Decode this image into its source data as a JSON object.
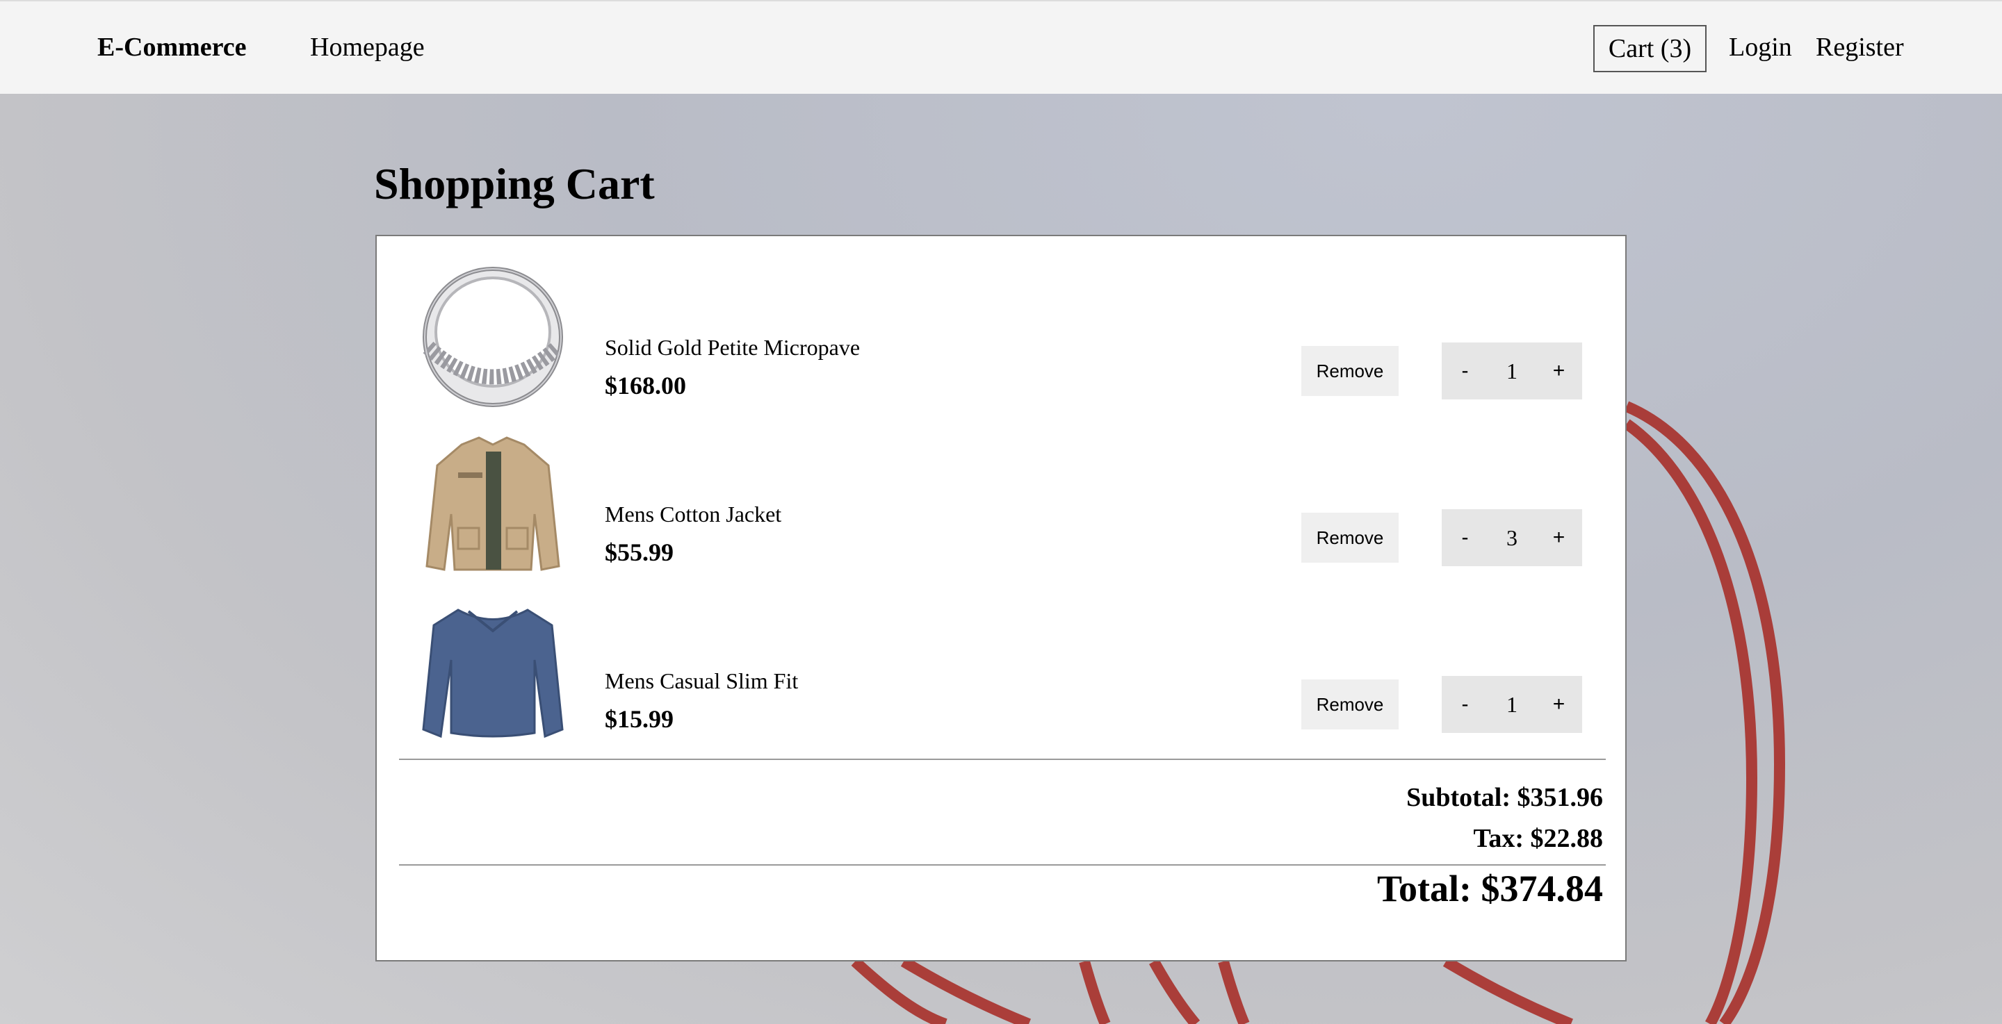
{
  "navbar": {
    "brand": "E-Commerce",
    "home": "Homepage",
    "cart": "Cart (3)",
    "login": "Login",
    "register": "Register"
  },
  "page": {
    "title": "Shopping Cart"
  },
  "cart": {
    "remove_label": "Remove",
    "minus_label": "-",
    "plus_label": "+",
    "items": [
      {
        "name": "Solid Gold Petite Micropave",
        "price": "$168.00",
        "quantity": "1",
        "image": "ring-icon"
      },
      {
        "name": "Mens Cotton Jacket",
        "price": "$55.99",
        "quantity": "3",
        "image": "jacket-icon"
      },
      {
        "name": "Mens Casual Slim Fit",
        "price": "$15.99",
        "quantity": "1",
        "image": "shirt-icon"
      }
    ],
    "subtotal": "Subtotal: $351.96",
    "tax": "Tax: $22.88",
    "total": "Total: $374.84"
  },
  "colors": {
    "navbar_bg": "#f4f4f4",
    "button_bg": "#efefef",
    "qty_bg": "#e6e6e6",
    "accent_red": "#a8302a"
  }
}
